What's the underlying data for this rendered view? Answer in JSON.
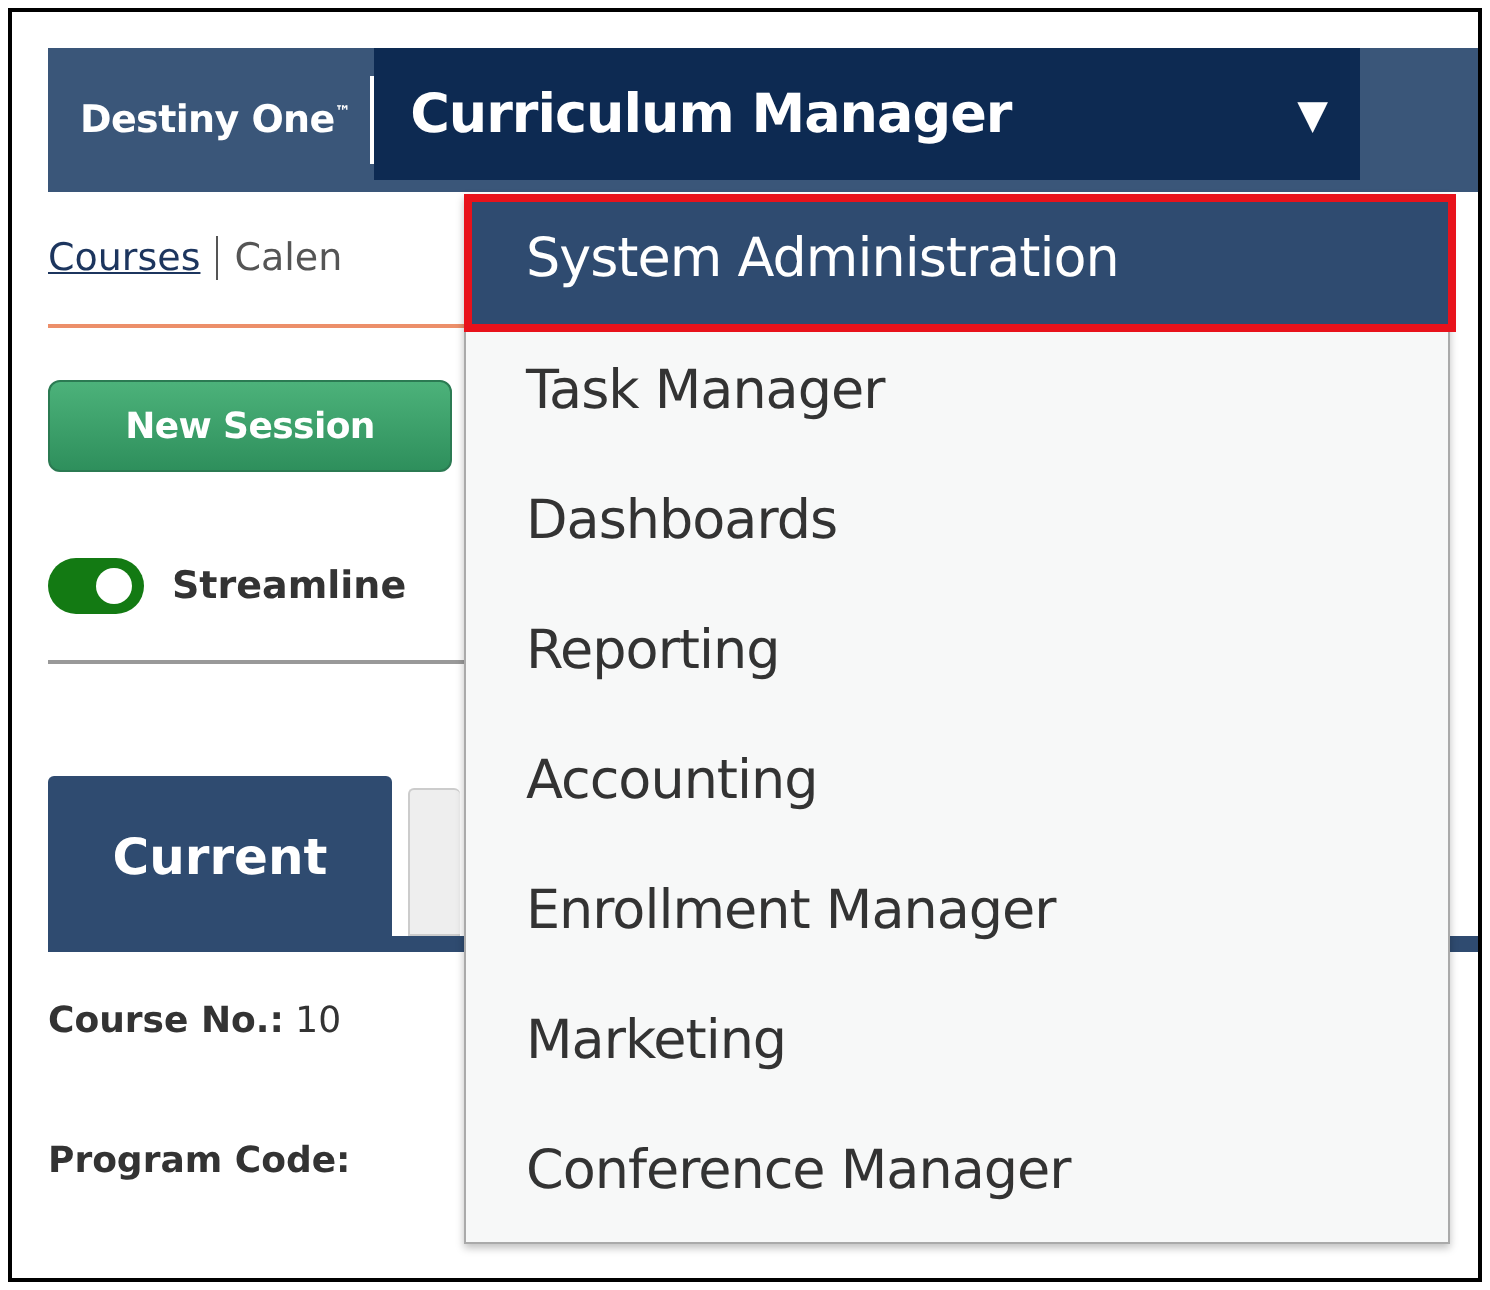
{
  "top_bar": {
    "brand": "Destiny One$^{™}$",
    "module": "Curriculum Manager",
    "caret": "▼"
  },
  "nav_links": [
    {
      "label": "Courses",
      "current": true
    },
    {
      "label": "Calen",
      "current": false
    }
  ],
  "new_session_button": "New Session",
  "toggle": {
    "label": "Streamline",
    "on": true
  },
  "tabs": [
    {
      "label": "Current",
      "selected": true
    },
    {
      "selected": false
    }
  ],
  "fields": [
    {
      "label": "Course No.:",
      "value": "10"
    },
    {
      "label": "Program Code:"
    }
  ],
  "module_menu": [
    {
      "label": "System Administration",
      "selected": true
    },
    {
      "label": "Task Manager",
      "selected": false
    },
    {
      "label": "Dashboards",
      "selected": false
    },
    {
      "label": "Reporting",
      "selected": false
    },
    {
      "label": "Accounting",
      "selected": false
    },
    {
      "label": "Enrollment Manager",
      "selected": false
    },
    {
      "label": "Marketing",
      "selected": false
    },
    {
      "label": "Conference Manager",
      "selected": false
    }
  ]
}
